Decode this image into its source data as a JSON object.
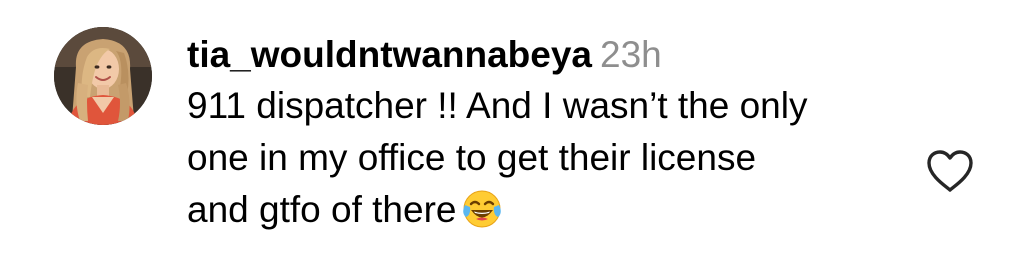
{
  "comment": {
    "username": "tia_wouldntwannabeya",
    "time": "23h",
    "text_lines": [
      "911 dispatcher !! And I wasn’t the only",
      "one in my office to get their license",
      "and gtfo of there"
    ],
    "emoji": "😂",
    "emoji_icon": "face-with-tears-of-joy-icon",
    "like_icon": "heart-outline-icon",
    "colors": {
      "username": "#000000",
      "time": "#8e8e8e",
      "heart_outline": "#262626"
    }
  }
}
